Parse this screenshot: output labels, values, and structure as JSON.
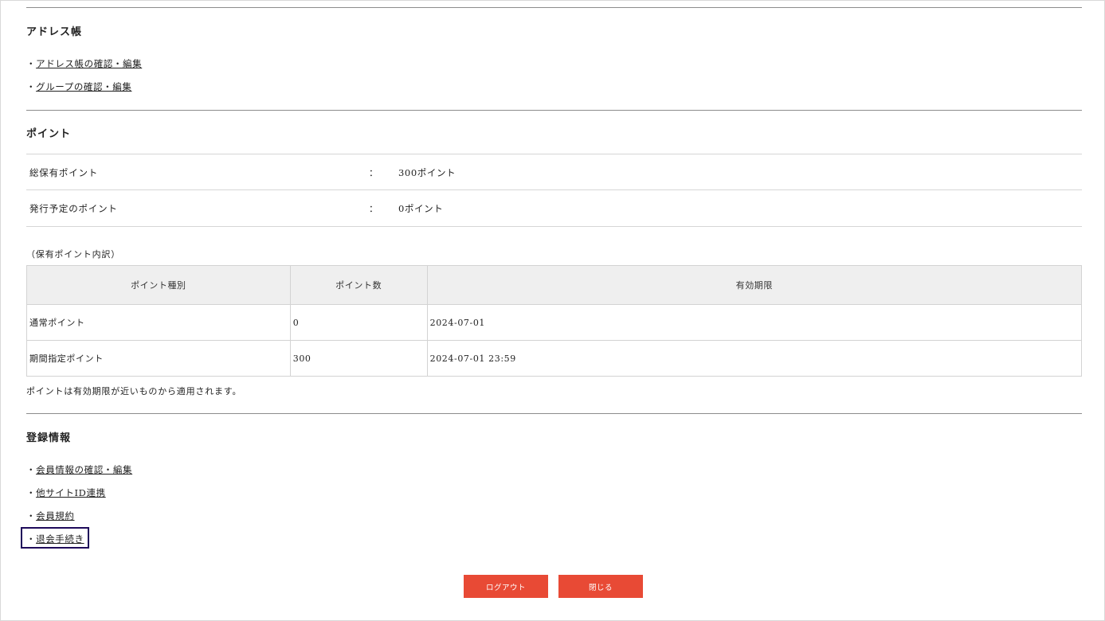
{
  "address_book": {
    "title": "アドレス帳",
    "links": [
      {
        "label": "アドレス帳の確認・編集"
      },
      {
        "label": "グループの確認・編集"
      }
    ]
  },
  "points": {
    "title": "ポイント",
    "rows": [
      {
        "label": "総保有ポイント",
        "colon": "：",
        "value": "300ポイント"
      },
      {
        "label": "発行予定のポイント",
        "colon": "：",
        "value": "0ポイント"
      }
    ],
    "breakdown_label": "（保有ポイント内訳）",
    "table": {
      "headers": [
        "ポイント種別",
        "ポイント数",
        "有効期限"
      ],
      "rows": [
        [
          "通常ポイント",
          "0",
          "2024-07-01"
        ],
        [
          "期間指定ポイント",
          "300",
          "2024-07-01 23:59"
        ]
      ]
    },
    "note": "ポイントは有効期限が近いものから適用されます。"
  },
  "registration": {
    "title": "登録情報",
    "links": [
      {
        "label": "会員情報の確認・編集"
      },
      {
        "label": "他サイトID連携"
      },
      {
        "label": "会員規約"
      },
      {
        "label": "退会手続き"
      }
    ]
  },
  "buttons": {
    "logout": "ログアウト",
    "close": "閉じる"
  },
  "bullet": "・",
  "colors": {
    "button": "#e84a35",
    "highlight": "#1e0a5a"
  }
}
